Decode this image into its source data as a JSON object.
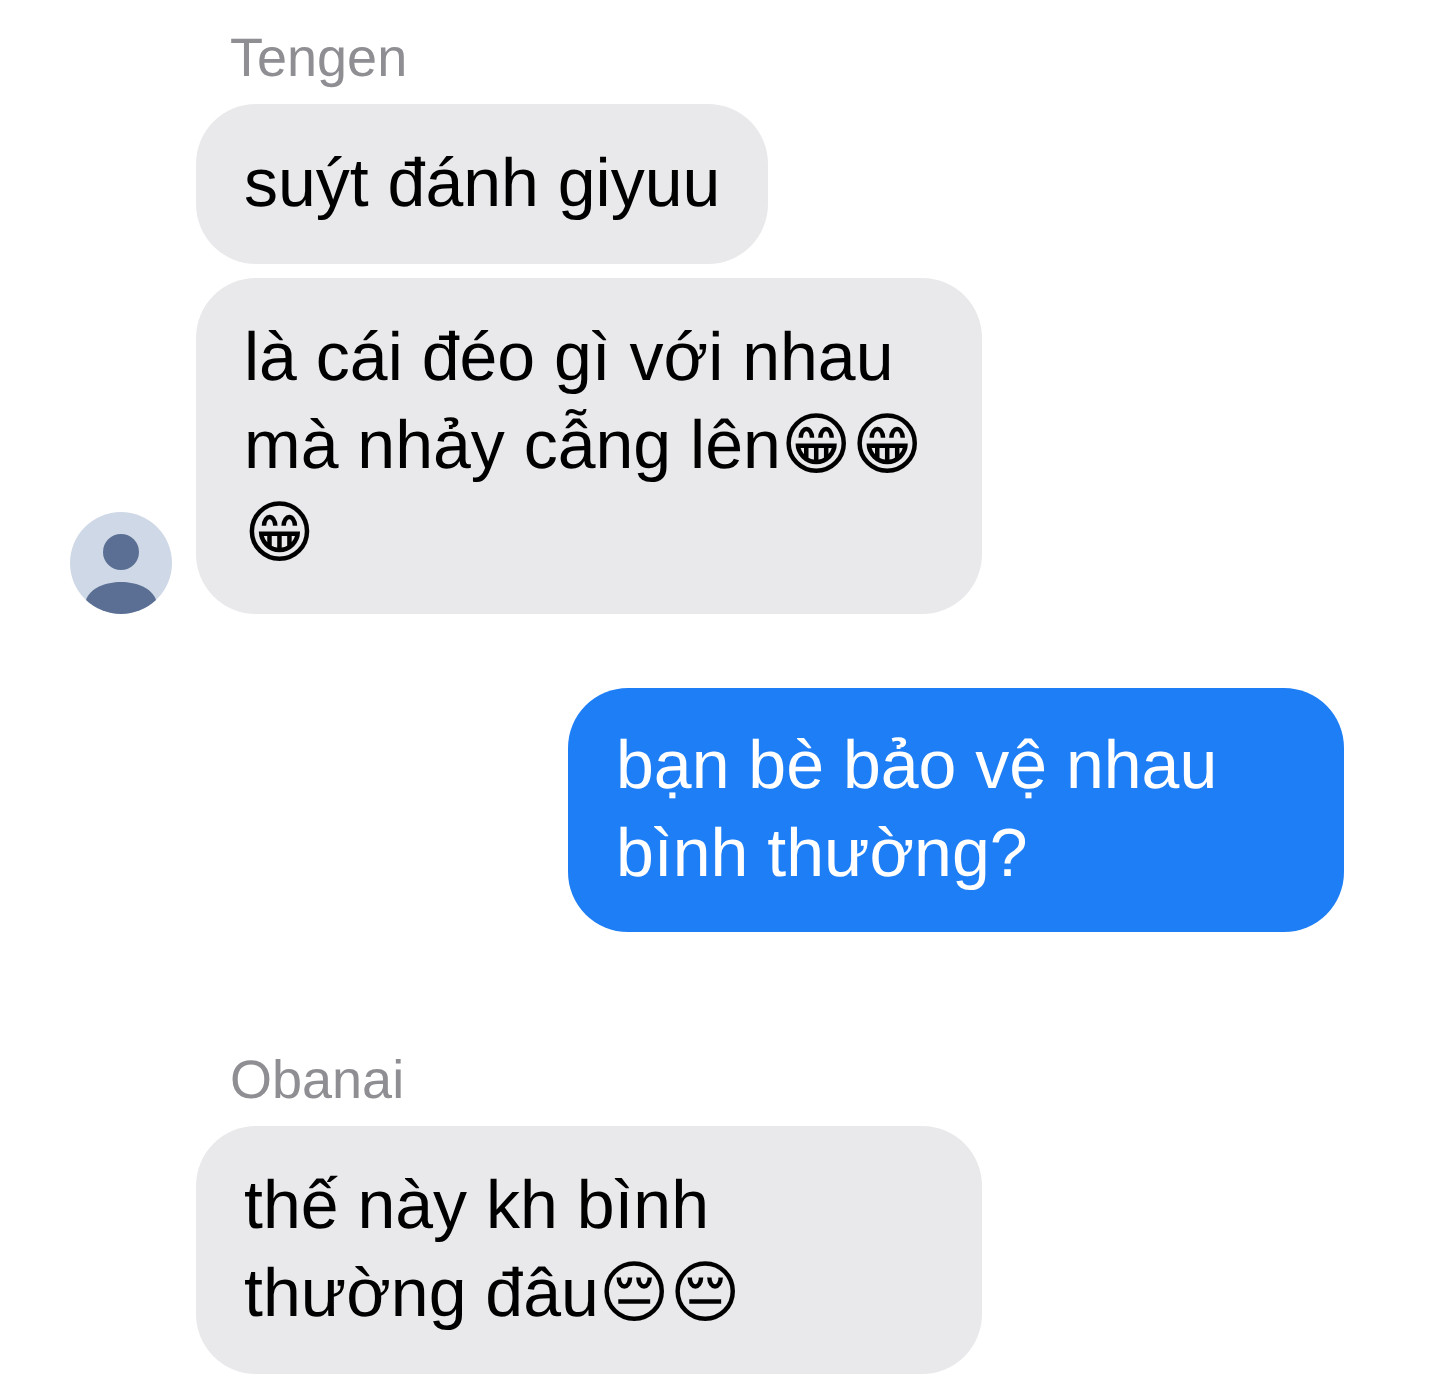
{
  "messages": [
    {
      "kind": "name",
      "text": "Tengen"
    },
    {
      "kind": "incoming",
      "text": "suýt đánh giyuu",
      "avatar": false
    },
    {
      "kind": "incoming",
      "text": "là cái đéo gì với nhau mà nhảy cẫng lên😁😁😁",
      "avatar": true
    },
    {
      "kind": "outgoing",
      "text": "bạn bè bảo vệ nhau bình thường?"
    },
    {
      "kind": "name",
      "text": "Obanai"
    },
    {
      "kind": "incoming",
      "text": "thế này kh bình thường đâu😔😔",
      "avatar": false
    }
  ]
}
